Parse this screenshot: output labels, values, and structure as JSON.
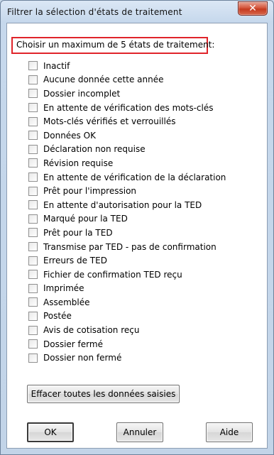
{
  "window": {
    "title": "Filtrer la sélection d'états de traitement",
    "close_symbol": "✕"
  },
  "header": {
    "label": "Choisir un maximum de 5 états de traitement:"
  },
  "options": [
    "Inactif",
    "Aucune donnée cette année",
    "Dossier incomplet",
    "En attente de vérification des mots-clés",
    "Mots-clés vérifiés et verrouillés",
    "Données OK",
    "Déclaration non requise",
    "Révision requise",
    "En attente de vérification de la déclaration",
    "Prêt pour l'impression",
    "En attente d'autorisation pour la TED",
    "Marqué pour la TED",
    "Prêt pour la TED",
    "Transmise par TED - pas de confirmation",
    "Erreurs de TED",
    "Fichier de confirmation TED reçu",
    "Imprimée",
    "Assemblée",
    "Postée",
    "Avis de cotisation reçu",
    "Dossier fermé",
    "Dossier non fermé"
  ],
  "buttons": {
    "clear": "Effacer toutes les données saisies",
    "ok": "OK",
    "cancel": "Annuler",
    "help": "Aide"
  },
  "colors": {
    "highlight_border": "#e0242a",
    "close_button": "#c53a1f"
  }
}
